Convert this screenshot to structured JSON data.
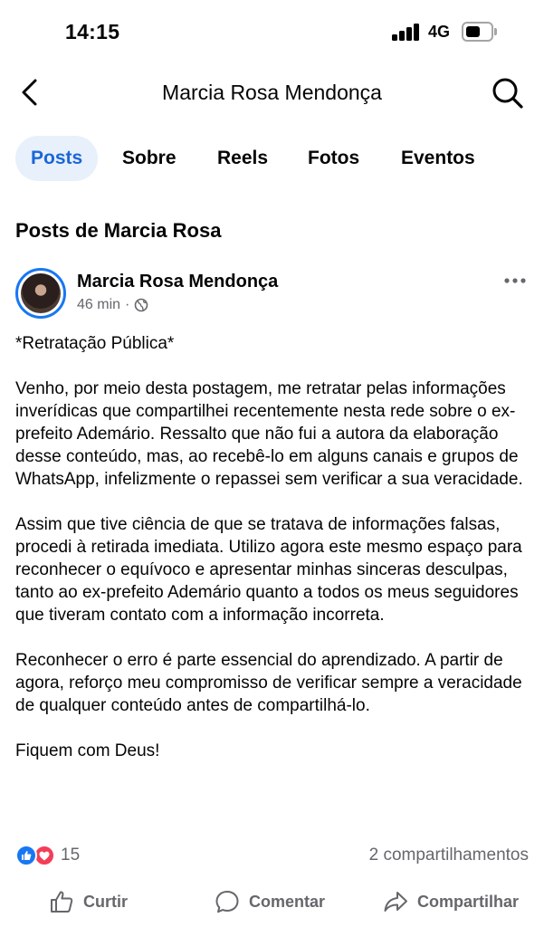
{
  "status_bar": {
    "time": "14:15",
    "network": "4G"
  },
  "nav": {
    "title": "Marcia Rosa Mendonça"
  },
  "tabs": [
    {
      "label": "Posts",
      "active": true
    },
    {
      "label": "Sobre"
    },
    {
      "label": "Reels"
    },
    {
      "label": "Fotos"
    },
    {
      "label": "Eventos"
    }
  ],
  "section_title": "Posts de Marcia Rosa",
  "post": {
    "author": "Marcia Rosa Mendonça",
    "time": "46 min",
    "separator": "·",
    "audience_icon": "globe-icon",
    "paragraphs": [
      "*Retratação Pública*",
      "Venho, por meio desta postagem, me retratar pelas informações inverídicas que compartilhei recentemente nesta rede sobre o ex-prefeito Ademário. Ressalto que não fui a autora da elaboração desse conteúdo, mas, ao recebê-lo em alguns canais e grupos de WhatsApp, infelizmente o repassei sem verificar a sua veracidade.",
      "Assim que tive ciência de que se tratava de informações falsas, procedi à retirada imediata. Utilizo agora este mesmo espaço para reconhecer o equívoco e apresentar minhas sinceras desculpas, tanto ao ex-prefeito Ademário quanto a todos os meus seguidores que tiveram contato com a informação incorreta.",
      "Reconhecer o erro é parte essencial do aprendizado. A partir de agora, reforço meu compromisso de verificar sempre a veracidade de qualquer conteúdo antes de compartilhá-lo.",
      "Fiquem com Deus!"
    ],
    "reaction_count": "15",
    "shares": "2 compartilhamentos"
  },
  "actions": {
    "like": "Curtir",
    "comment": "Comentar",
    "share": "Compartilhar"
  },
  "colors": {
    "accent": "#1877f2",
    "active_tab_bg": "#e7f0fb",
    "active_tab_text": "#1b66d8",
    "secondary_text": "#65676b",
    "love": "#f33e58"
  }
}
